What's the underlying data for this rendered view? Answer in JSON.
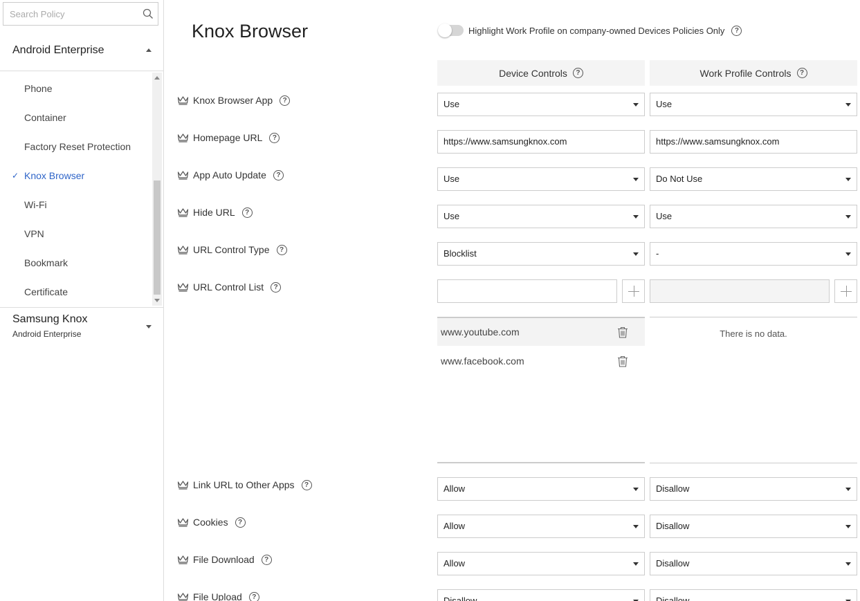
{
  "sidebar": {
    "search_placeholder": "Search Policy",
    "group_android": "Android Enterprise",
    "items": [
      {
        "label": "Phone"
      },
      {
        "label": "Container"
      },
      {
        "label": "Factory Reset Protection"
      },
      {
        "label": "Knox Browser",
        "active": true
      },
      {
        "label": "Wi-Fi"
      },
      {
        "label": "VPN"
      },
      {
        "label": "Bookmark"
      },
      {
        "label": "Certificate"
      }
    ],
    "check_mark": "✓",
    "group_samsung": "Samsung Knox",
    "group_samsung_sub": "Android Enterprise"
  },
  "main": {
    "title": "Knox Browser",
    "toggle_label": "Highlight Work Profile on company-owned Devices Policies Only",
    "help_glyph": "?",
    "columns": {
      "device": "Device Controls",
      "work_profile": "Work Profile Controls"
    },
    "rows": [
      {
        "label": "Knox Browser App",
        "device": "Use",
        "work_profile": "Use"
      },
      {
        "label": "Homepage URL",
        "device": "https://www.samsungknox.com",
        "work_profile": "https://www.samsungknox.com"
      },
      {
        "label": "App Auto Update",
        "device": "Use",
        "work_profile": "Do Not Use"
      },
      {
        "label": "Hide URL",
        "device": "Use",
        "work_profile": "Use"
      },
      {
        "label": "URL Control Type",
        "device": "Blocklist",
        "work_profile": "-"
      },
      {
        "label": "URL Control List"
      },
      {
        "label": "Link URL to Other Apps",
        "device": "Allow",
        "work_profile": "Disallow"
      },
      {
        "label": "Cookies",
        "device": "Allow",
        "work_profile": "Disallow"
      },
      {
        "label": "File Download",
        "device": "Allow",
        "work_profile": "Disallow"
      },
      {
        "label": "File Upload",
        "device": "Disallow",
        "work_profile": "Disallow"
      }
    ],
    "url_list": {
      "device_items": [
        "www.youtube.com",
        "www.facebook.com"
      ],
      "work_profile_empty": "There is no data."
    }
  },
  "colors": {
    "accent": "#2e64c8",
    "header_bg": "#f4f4f4"
  }
}
